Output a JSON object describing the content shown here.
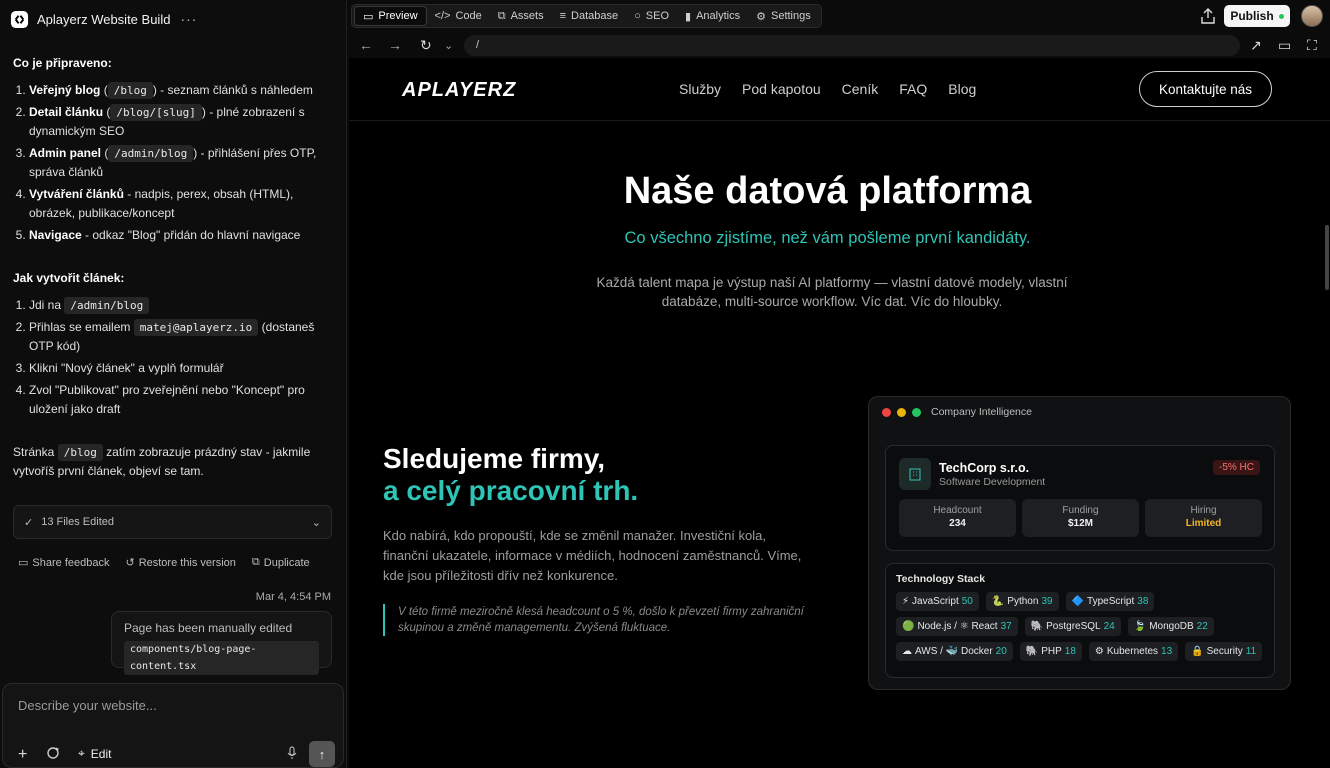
{
  "project": {
    "name": "Aplayerz Website Build",
    "more": "···"
  },
  "chat": {
    "ready_title": "Co je připraveno:",
    "features": [
      {
        "bold": "Veřejný blog",
        "pre": " (",
        "code": "/blog",
        "post": ") - seznam článků s náhledem"
      },
      {
        "bold": "Detail článku",
        "pre": " (",
        "code": "/blog/[slug]",
        "post": ") - plné zobrazení s dynamickým SEO"
      },
      {
        "bold": "Admin panel",
        "pre": " (",
        "code": "/admin/blog",
        "post": ") - přihlášení přes OTP, správa článků"
      },
      {
        "bold": "Vytváření článků",
        "text": " - nadpis, perex, obsah (HTML), obrázek, publikace/koncept"
      },
      {
        "bold": "Navigace",
        "text": " - odkaz \"Blog\" přidán do hlavní navigace"
      }
    ],
    "howto_title": "Jak vytvořit článek:",
    "steps": {
      "s1_pre": "Jdi na",
      "s1_code": "/admin/blog",
      "s2_pre": "Přihlas se emailem",
      "s2_code": "matej@aplayerz.io",
      "s2_post": "(dostaneš OTP kód)",
      "s3": "Klikni \"Nový článek\" a vyplň formulář",
      "s4": "Zvol \"Publikovat\" pro zveřejnění nebo \"Koncept\" pro uložení jako draft"
    },
    "footer_pre": "Stránka",
    "footer_code": "/blog",
    "footer_post": "zatím zobrazuje prázdný stav - jakmile vytvoříš první článek, objeví se tam.",
    "files_edited": "13 Files Edited",
    "actions": {
      "feedback": "Share feedback",
      "restore": "Restore this version",
      "duplicate": "Duplicate"
    },
    "timestamp": "Mar 4, 4:54 PM",
    "edited_note": "Page has been manually edited",
    "edited_file": "components/blog-page-content.tsx"
  },
  "composer": {
    "placeholder": "Describe your website...",
    "edit_label": "Edit"
  },
  "toolbar": {
    "tabs": [
      "Preview",
      "Code",
      "Assets",
      "Database",
      "SEO",
      "Analytics",
      "Settings"
    ],
    "publish": "Publish"
  },
  "url": "/",
  "site": {
    "brand": "APLAYERZ",
    "nav": [
      "Služby",
      "Pod kapotou",
      "Ceník",
      "FAQ",
      "Blog"
    ],
    "contact": "Kontaktujte nás",
    "hero_title": "Naše datová platforma",
    "hero_sub": "Co všechno zjistíme, než vám pošleme první kandidáty.",
    "hero_desc": "Každá talent mapa je výstup naší AI platformy — vlastní datové modely, vlastní databáze, multi-source workflow. Víc dat. Víc do hloubky.",
    "sec_title_1": "Sledujeme firmy,",
    "sec_title_2": "a celý pracovní trh.",
    "sec_desc": "Kdo nabírá, kdo propouští, kde se změnil manažer. Investiční kola, finanční ukazatele, informace v médiích, hodnocení zaměstnanců. Víme, kde jsou příležitosti dřív než konkurence.",
    "sec_quote": "V této firmě meziročně klesá headcount o 5 %, došlo k převzetí firmy zahraniční skupinou a změně managementu. Zvýšená fluktuace."
  },
  "card": {
    "title": "Company Intelligence",
    "company": "TechCorp s.r.o.",
    "industry": "Software Development",
    "badge": "-5% HC",
    "stats": [
      {
        "label": "Headcount",
        "value": "234"
      },
      {
        "label": "Funding",
        "value": "$12M"
      },
      {
        "label": "Hiring",
        "value": "Limited"
      }
    ],
    "tech_title": "Technology Stack",
    "tech": [
      {
        "icon": "⚡",
        "name": "JavaScript",
        "count": "50"
      },
      {
        "icon": "🐍",
        "name": "Python",
        "count": "39"
      },
      {
        "icon": "🔷",
        "name": "TypeScript",
        "count": "38"
      },
      {
        "icon": "🟢",
        "name": "Node.js / ⚛ React",
        "count": "37"
      },
      {
        "icon": "🐘",
        "name": "PostgreSQL",
        "count": "24"
      },
      {
        "icon": "🍃",
        "name": "MongoDB",
        "count": "22"
      },
      {
        "icon": "☁",
        "name": "AWS / 🐳 Docker",
        "count": "20"
      },
      {
        "icon": "🐘",
        "name": "PHP",
        "count": "18"
      },
      {
        "icon": "⚙",
        "name": "Kubernetes",
        "count": "13"
      },
      {
        "icon": "🔒",
        "name": "Security",
        "count": "11"
      }
    ]
  },
  "colors": {
    "accent": "#2ec4b6",
    "warn": "#f5b625",
    "danger": "#f87171"
  }
}
